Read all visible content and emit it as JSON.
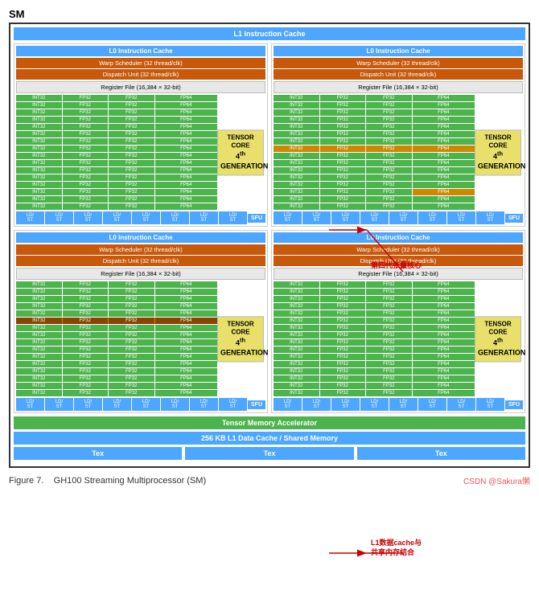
{
  "title": "SM",
  "l1_cache_top": "L1 Instruction Cache",
  "l0_cache": "L0 Instruction Cache",
  "warp_scheduler": "Warp Scheduler (32 thread/clk)",
  "dispatch_unit": "Dispatch Unit (32 thread/clk)",
  "reg_file": "Register File (16,384 × 32-bit)",
  "tensor_core": {
    "label": "TENSOR CORE",
    "generation": "4th GENERATION"
  },
  "sfu": "SFU",
  "ld_st": "LD/ ST",
  "tensor_mem": "Tensor Memory Accelerator",
  "l1_data_cache": "256 KB L1 Data Cache / Shared Memory",
  "tex": "Tex",
  "int32": "INT32",
  "fp32": "FP32",
  "fp64": "FP64",
  "figure": "Figure 7.    GH100 Streaming Multiprocessor (SM)",
  "csdn": "CSDN @Sakura懒",
  "annotation1": "第四代张量核心",
  "annotation2": "L1数据cache与\n共享内存结合",
  "rows_count": 16
}
